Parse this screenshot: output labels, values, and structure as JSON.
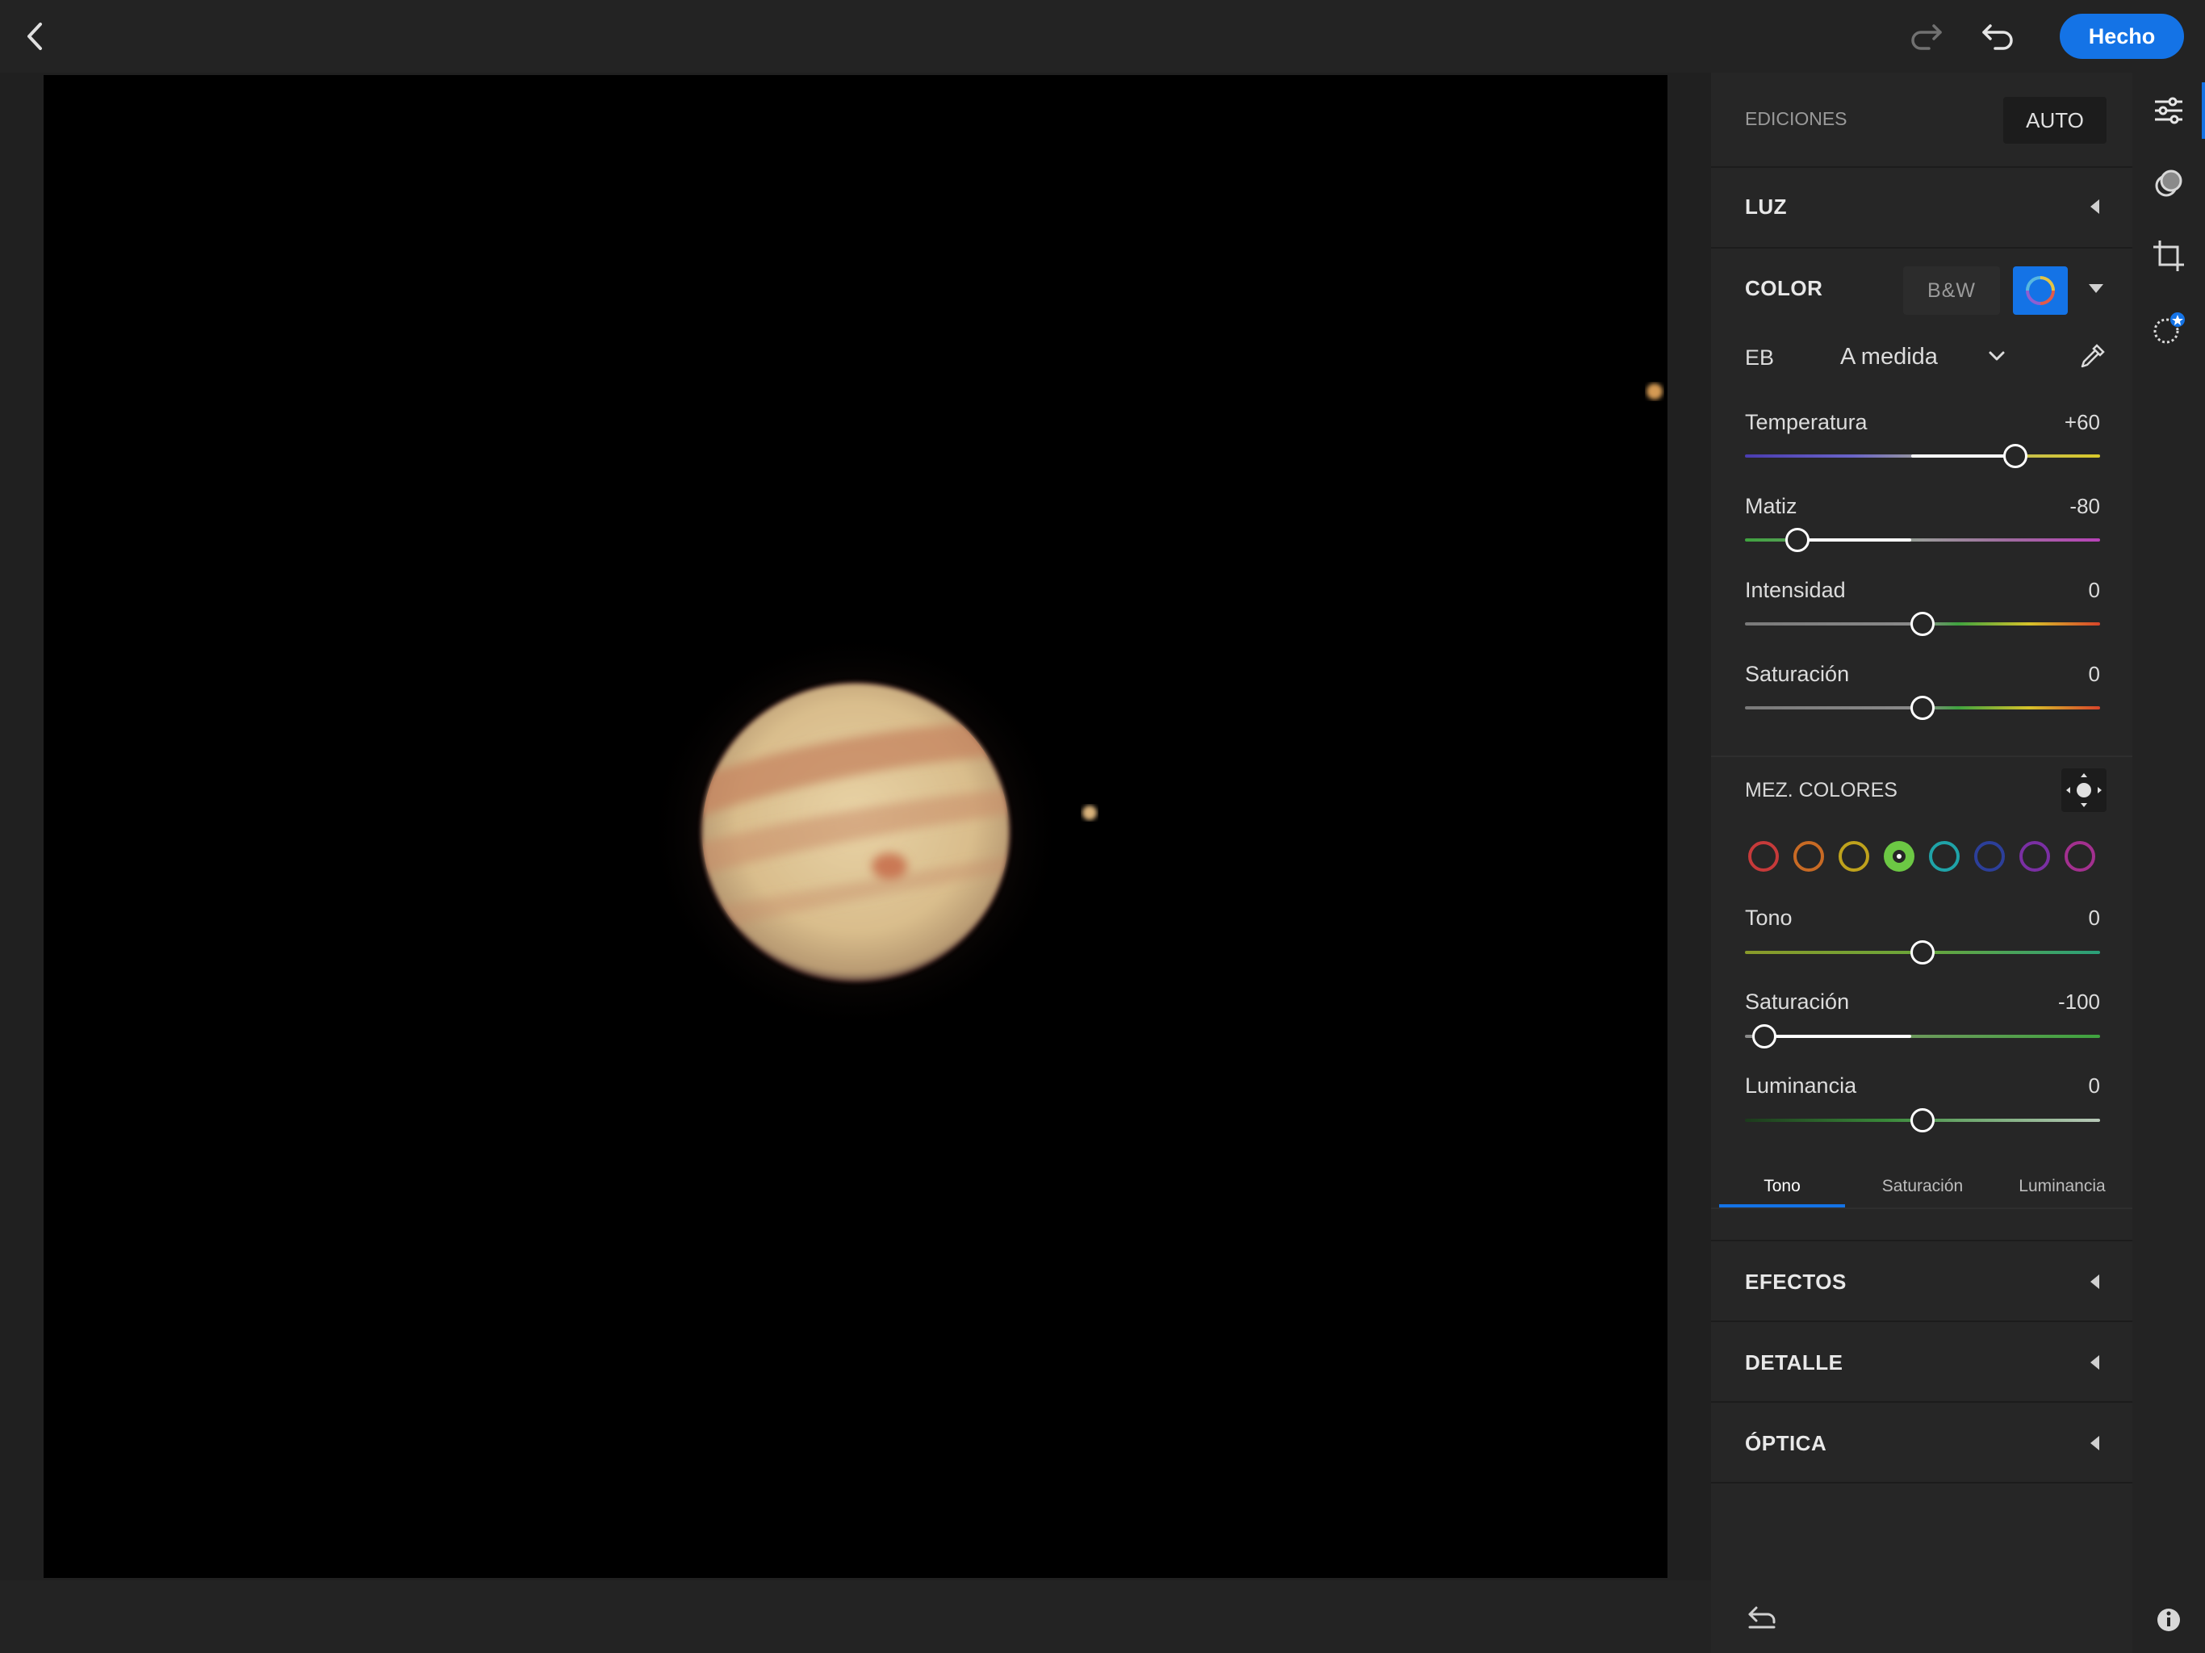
{
  "header": {
    "done_label": "Hecho"
  },
  "panel": {
    "title": "EDICIONES",
    "auto_label": "AUTO",
    "sections": {
      "light": "LUZ",
      "color": "COLOR",
      "effects": "EFECTOS",
      "detail": "DETALLE",
      "optics": "ÓPTICA"
    },
    "bw_label": "B&W",
    "wb_label": "EB",
    "wb_value": "A medida",
    "sliders": {
      "temperature": {
        "label": "Temperatura",
        "value": "+60"
      },
      "tint": {
        "label": "Matiz",
        "value": "-80"
      },
      "vibrance": {
        "label": "Intensidad",
        "value": "0"
      },
      "saturation": {
        "label": "Saturación",
        "value": "0"
      }
    },
    "mixer": {
      "title": "MEZ. COLORES",
      "swatches": [
        "red",
        "orange",
        "yellow",
        "green",
        "aqua",
        "blue",
        "purple",
        "magenta"
      ],
      "selected": "green",
      "swatch_colors": [
        "#c63a3a",
        "#c86a24",
        "#bfa21c",
        "#6cc844",
        "#1fa3a8",
        "#2c3f9a",
        "#7a2fa3",
        "#a3308f"
      ],
      "sliders": {
        "hue": {
          "label": "Tono",
          "value": "0"
        },
        "sat": {
          "label": "Saturación",
          "value": "-100"
        },
        "lum": {
          "label": "Luminancia",
          "value": "0"
        }
      },
      "tabs": [
        "Tono",
        "Saturación",
        "Luminancia"
      ],
      "active_tab": "Tono"
    }
  },
  "rail": {
    "icons": [
      "sliders-icon",
      "presets-icon",
      "crop-icon",
      "heal-icon"
    ]
  }
}
